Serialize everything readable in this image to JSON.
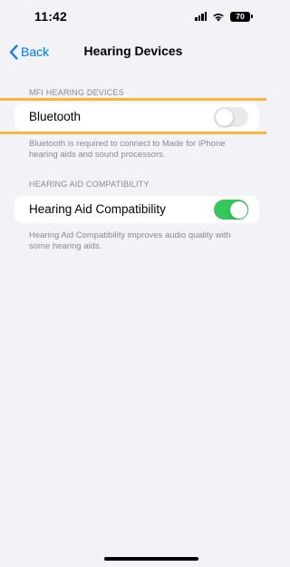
{
  "status_bar": {
    "time": "11:42",
    "battery": "70",
    "icons": [
      "cellular-signal-icon",
      "wifi-icon",
      "battery-icon"
    ]
  },
  "nav": {
    "back_label": "Back",
    "title": "Hearing Devices"
  },
  "sections": {
    "mfi": {
      "header": "MFI HEARING DEVICES",
      "row_label": "Bluetooth",
      "toggle_on": false,
      "footer": "Bluetooth is required to connect to Made for iPhone hearing aids and sound processors."
    },
    "hac": {
      "header": "HEARING AID COMPATIBILITY",
      "row_label": "Hearing Aid Compatibility",
      "toggle_on": true,
      "footer": "Hearing Aid Compatibility improves audio quality with some hearing aids."
    }
  },
  "colors": {
    "accent": "#007aff",
    "toggle_on": "#34c759",
    "toggle_off": "#e9e9eb",
    "highlight": "#f5b73b",
    "background": "#f2f2f7"
  }
}
